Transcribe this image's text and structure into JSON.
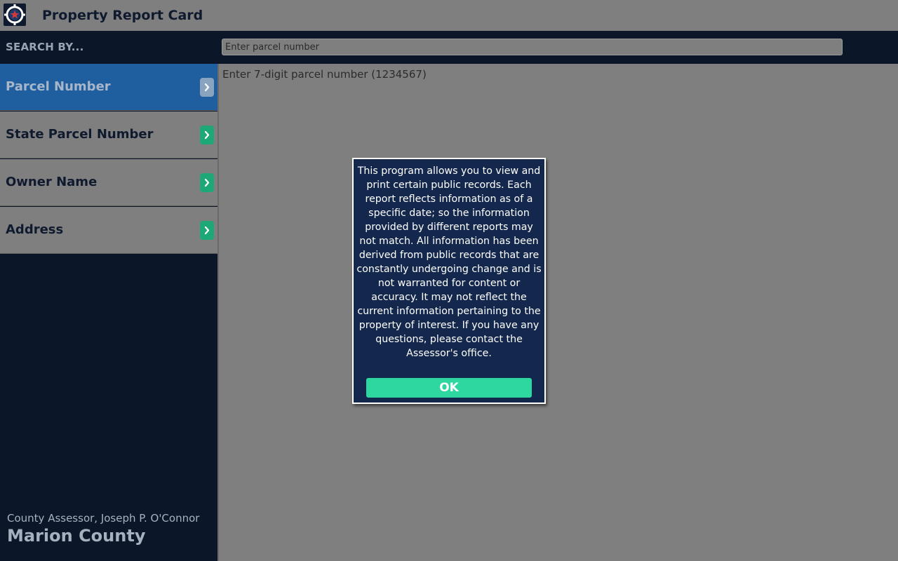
{
  "app": {
    "title": "Property Report Card",
    "logo_icon": "county-star-seal-icon"
  },
  "search": {
    "by_label": "SEARCH BY...",
    "placeholder": "Enter parcel number",
    "value": "",
    "hint": "Enter 7-digit parcel number (1234567)"
  },
  "sidebar": {
    "items": [
      {
        "label": "Parcel Number",
        "active": true,
        "icon": "chevron-right-icon"
      },
      {
        "label": "State Parcel Number",
        "active": false,
        "icon": "chevron-right-icon"
      },
      {
        "label": "Owner Name",
        "active": false,
        "icon": "chevron-right-icon"
      },
      {
        "label": "Address",
        "active": false,
        "icon": "chevron-right-icon"
      }
    ],
    "footer": {
      "assessor": "County Assessor, Joseph P. O'Connor",
      "county": "Marion County"
    }
  },
  "modal": {
    "message": "This program allows you to view and print certain public records. Each report reflects information as of a specific date; so the information provided by different reports may not match. All information has been derived from public records that are constantly undergoing change and is not warranted for content or accuracy. It may not reflect the current information pertaining to the property of interest. If you have any questions, please contact the Assessor's office.",
    "ok_label": "OK"
  },
  "colors": {
    "navy": "#0b1629",
    "active_blue": "#1f5fa0",
    "accent_green": "#2ed6a0",
    "chevron_green": "#1fa877",
    "modal_bg": "#14284d",
    "overlay_gray": "#7f7f7f"
  }
}
